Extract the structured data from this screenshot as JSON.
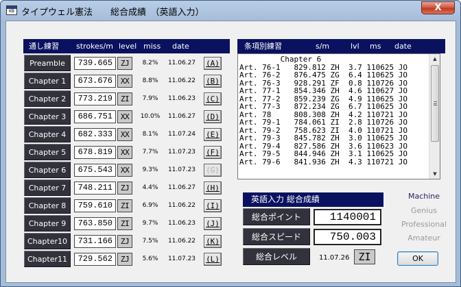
{
  "window": {
    "title": "タイプウェル憲法　　総合成績　（英語入力）",
    "close_label": "X"
  },
  "left_panel": {
    "headers": [
      "通し練習",
      "strokes/m",
      "level",
      "miss",
      "date"
    ],
    "rows": [
      {
        "label": "Preamble",
        "strokes": "739.665",
        "level": "ZJ",
        "miss": "8.2%",
        "date": "11.06.27",
        "key": "(A)",
        "key_enabled": true
      },
      {
        "label": "Chapter 1",
        "strokes": "673.676",
        "level": "XX",
        "miss": "8.8%",
        "date": "11.06.22",
        "key": "(B)",
        "key_enabled": true
      },
      {
        "label": "Chapter 2",
        "strokes": "773.219",
        "level": "ZI",
        "miss": "7.9%",
        "date": "11.06.23",
        "key": "(C)",
        "key_enabled": true
      },
      {
        "label": "Chapter 3",
        "strokes": "686.751",
        "level": "XX",
        "miss": "10.0%",
        "date": "11.06.27",
        "key": "(D)",
        "key_enabled": true
      },
      {
        "label": "Chapter 4",
        "strokes": "682.333",
        "level": "XX",
        "miss": "8.1%",
        "date": "11.07.24",
        "key": "(E)",
        "key_enabled": true
      },
      {
        "label": "Chapter 5",
        "strokes": "678.819",
        "level": "XX",
        "miss": "7.7%",
        "date": "11.07.23",
        "key": "(F)",
        "key_enabled": true
      },
      {
        "label": "Chapter 6",
        "strokes": "675.543",
        "level": "XX",
        "miss": "9.3%",
        "date": "11.07.23",
        "key": "(G)",
        "key_enabled": false
      },
      {
        "label": "Chapter 7",
        "strokes": "748.211",
        "level": "ZJ",
        "miss": "4.4%",
        "date": "11.06.27",
        "key": "(H)",
        "key_enabled": true
      },
      {
        "label": "Chapter 8",
        "strokes": "759.610",
        "level": "ZI",
        "miss": "6.9%",
        "date": "11.06.22",
        "key": "(I)",
        "key_enabled": true
      },
      {
        "label": "Chapter 9",
        "strokes": "763.850",
        "level": "ZI",
        "miss": "9.7%",
        "date": "11.06.23",
        "key": "(J)",
        "key_enabled": true
      },
      {
        "label": "Chapter10",
        "strokes": "731.166",
        "level": "ZJ",
        "miss": "7.5%",
        "date": "11.06.22",
        "key": "(K)",
        "key_enabled": true
      },
      {
        "label": "Chapter11",
        "strokes": "729.562",
        "level": "ZJ",
        "miss": "5.6%",
        "date": "11.07.23",
        "key": "(L)",
        "key_enabled": true
      }
    ]
  },
  "right_panel": {
    "headers": [
      "条項別練習",
      "s/m",
      "lvl",
      "ms",
      "date"
    ],
    "lines": [
      "         Chapter 6",
      "Art. 76-1   829.812 ZH  3.7 110625 JO",
      "Art. 76-2   876.475 ZG  6.4 110625 JO",
      "Art. 76-3   928.291 ZF  0.8 110726 JO",
      "Art. 77-1   854.346 ZH  4.6 110627 JO",
      "Art. 77-2   859.239 ZG  4.9 110625 JO",
      "Art. 77-3   872.234 ZG  6.7 110625 JO",
      "Art. 78     808.308 ZH  4.2 110721 JO",
      "Art. 79-1   784.061 ZI  2.8 110726 JO",
      "Art. 79-2   758.623 ZI  4.0 110721 JO",
      "Art. 79-3   845.782 ZH  3.0 110625 JO",
      "Art. 79-4   827.586 ZH  3.6 110623 JO",
      "Art. 79-5   844.946 ZH  3.1 110625 JO",
      "Art. 79-6   841.936 ZH  4.3 110721 JO"
    ]
  },
  "summary": {
    "header": "英語入力 総合成績",
    "points_label": "総合ポイント",
    "points_value": "1140001",
    "speed_label": "総合スピード",
    "speed_value": "750.003",
    "level_label": "総合レベル",
    "level_date": "11.07.26",
    "level_value": "ZI"
  },
  "modes": {
    "items": [
      "Machine",
      "Genius",
      "Professional",
      "Amateur"
    ],
    "active": "Machine"
  },
  "ok_label": "OK"
}
